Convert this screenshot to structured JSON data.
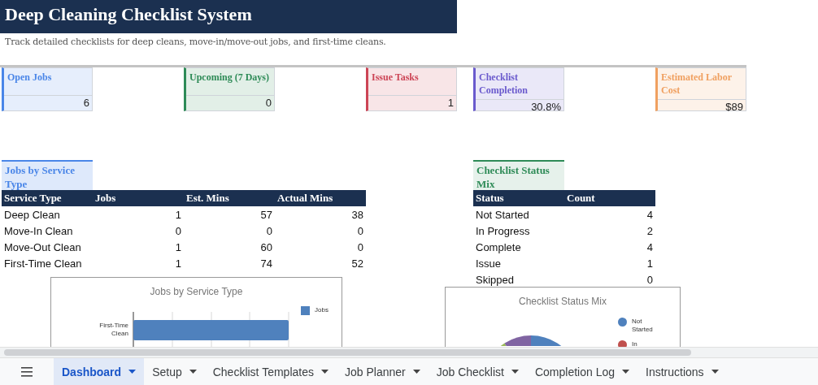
{
  "title": "Deep Cleaning Checklist System",
  "subtitle": "Track detailed checklists for deep cleans, move-in/move-out jobs, and first-time cleans.",
  "kpis": [
    {
      "label": "Open Jobs",
      "value": "6",
      "color": "#4a86e8"
    },
    {
      "label": "Upcoming (7 Days)",
      "value": "0",
      "color": "#2e8b57"
    },
    {
      "label": "Issue Tasks",
      "value": "1",
      "color": "#cc4455"
    },
    {
      "label": "Checklist Completion",
      "value": "30.8%",
      "color": "#6a5acd"
    },
    {
      "label": "Estimated Labor Cost",
      "value": "$89",
      "color": "#f0a060"
    }
  ],
  "tables": [
    {
      "heading": "Jobs by Service Type",
      "color": "#4a86e8",
      "columns": [
        "Service Type",
        "Jobs",
        "Est. Mins",
        "Actual Mins"
      ],
      "rows": [
        [
          "Deep Clean",
          "1",
          "57",
          "38"
        ],
        [
          "Move-In Clean",
          "0",
          "0",
          "0"
        ],
        [
          "Move-Out Clean",
          "1",
          "60",
          "0"
        ],
        [
          "First-Time Clean",
          "1",
          "74",
          "52"
        ]
      ]
    },
    {
      "heading": "Checklist Status Mix",
      "color": "#2e8b57",
      "columns": [
        "Status",
        "Count"
      ],
      "rows": [
        [
          "Not Started",
          "4"
        ],
        [
          "In Progress",
          "2"
        ],
        [
          "Complete",
          "4"
        ],
        [
          "Issue",
          "1"
        ],
        [
          "Skipped",
          "0"
        ]
      ]
    }
  ],
  "charts": [
    {
      "kind": "bar",
      "title": "Jobs by Service Type",
      "category": "First-Time Clean",
      "legend": [
        {
          "label": "Jobs",
          "color": "#4f81bd"
        }
      ]
    },
    {
      "kind": "pie",
      "title": "Checklist Status Mix",
      "legend": [
        {
          "label": "Not Started",
          "color": "#4f81bd"
        },
        {
          "label": "In",
          "color": "#c0504d"
        }
      ]
    }
  ],
  "tabs": [
    {
      "label": "Dashboard",
      "selected": true
    },
    {
      "label": "Setup",
      "selected": false
    },
    {
      "label": "Checklist Templates",
      "selected": false
    },
    {
      "label": "Job Planner",
      "selected": false
    },
    {
      "label": "Job Checklist",
      "selected": false
    },
    {
      "label": "Completion Log",
      "selected": false
    },
    {
      "label": "Instructions",
      "selected": false
    }
  ]
}
